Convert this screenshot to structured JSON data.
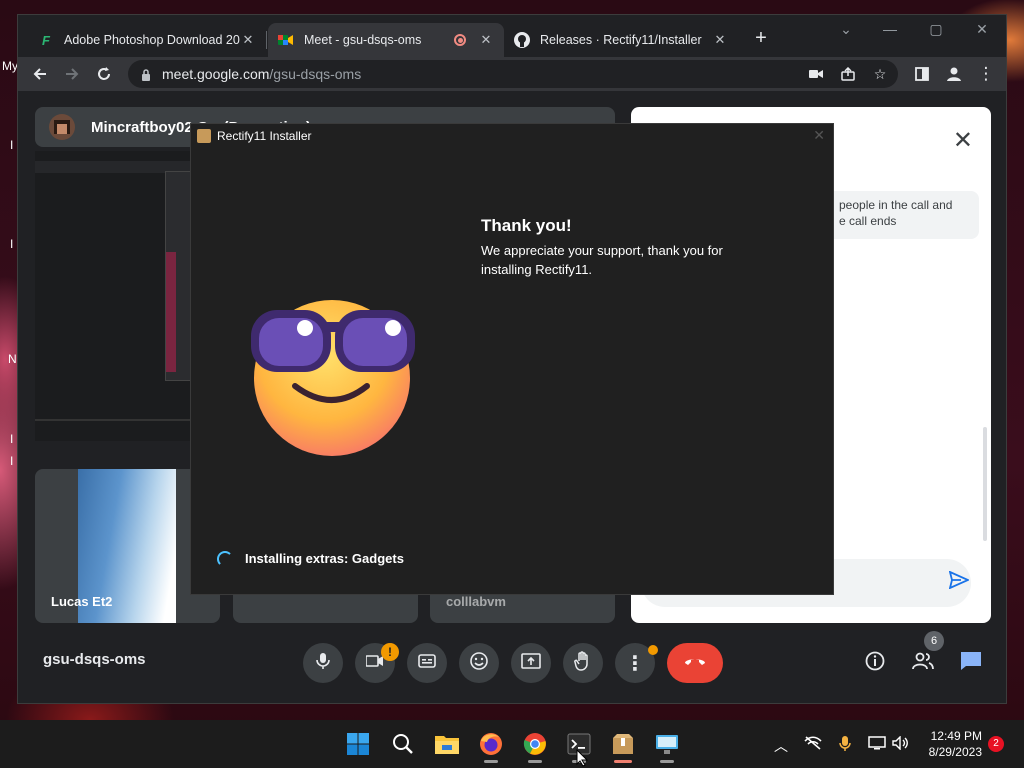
{
  "desktop": {
    "partial_text": "My",
    "letters": [
      "I",
      "I",
      "N",
      "I",
      "I"
    ]
  },
  "browser": {
    "tabs": [
      {
        "title": "Adobe Photoshop Download 20",
        "favicon": "filehorse-icon",
        "active": false
      },
      {
        "title": "Meet - gsu-dsqs-oms",
        "favicon": "google-meet-icon",
        "active": true,
        "recording": true
      },
      {
        "title": "Releases · Rectify11/Installer",
        "favicon": "github-icon",
        "active": false
      }
    ],
    "address": {
      "host": "meet.google.com",
      "path": "/gsu-dsqs-oms"
    }
  },
  "meet": {
    "presenter_label": "Mincraftboy02 G…(Presenting)",
    "tiles": [
      {
        "name": "Lucas Et2"
      },
      {
        "name": ""
      },
      {
        "name": "colllabvm"
      }
    ],
    "side_panel": {
      "note_line1": "people in the call and",
      "note_line2": "e call ends"
    },
    "meeting_code": "gsu-dsqs-oms",
    "camera_alert": "!",
    "people_count": "6"
  },
  "installer": {
    "window_title": "Rectify11 Installer",
    "heading": "Thank you!",
    "message": "We appreciate your support, thank you for installing Rectify11.",
    "status": "Installing extras: Gadgets"
  },
  "taskbar": {
    "time": "12:49 PM",
    "date": "8/29/2023",
    "notification_count": "2"
  }
}
